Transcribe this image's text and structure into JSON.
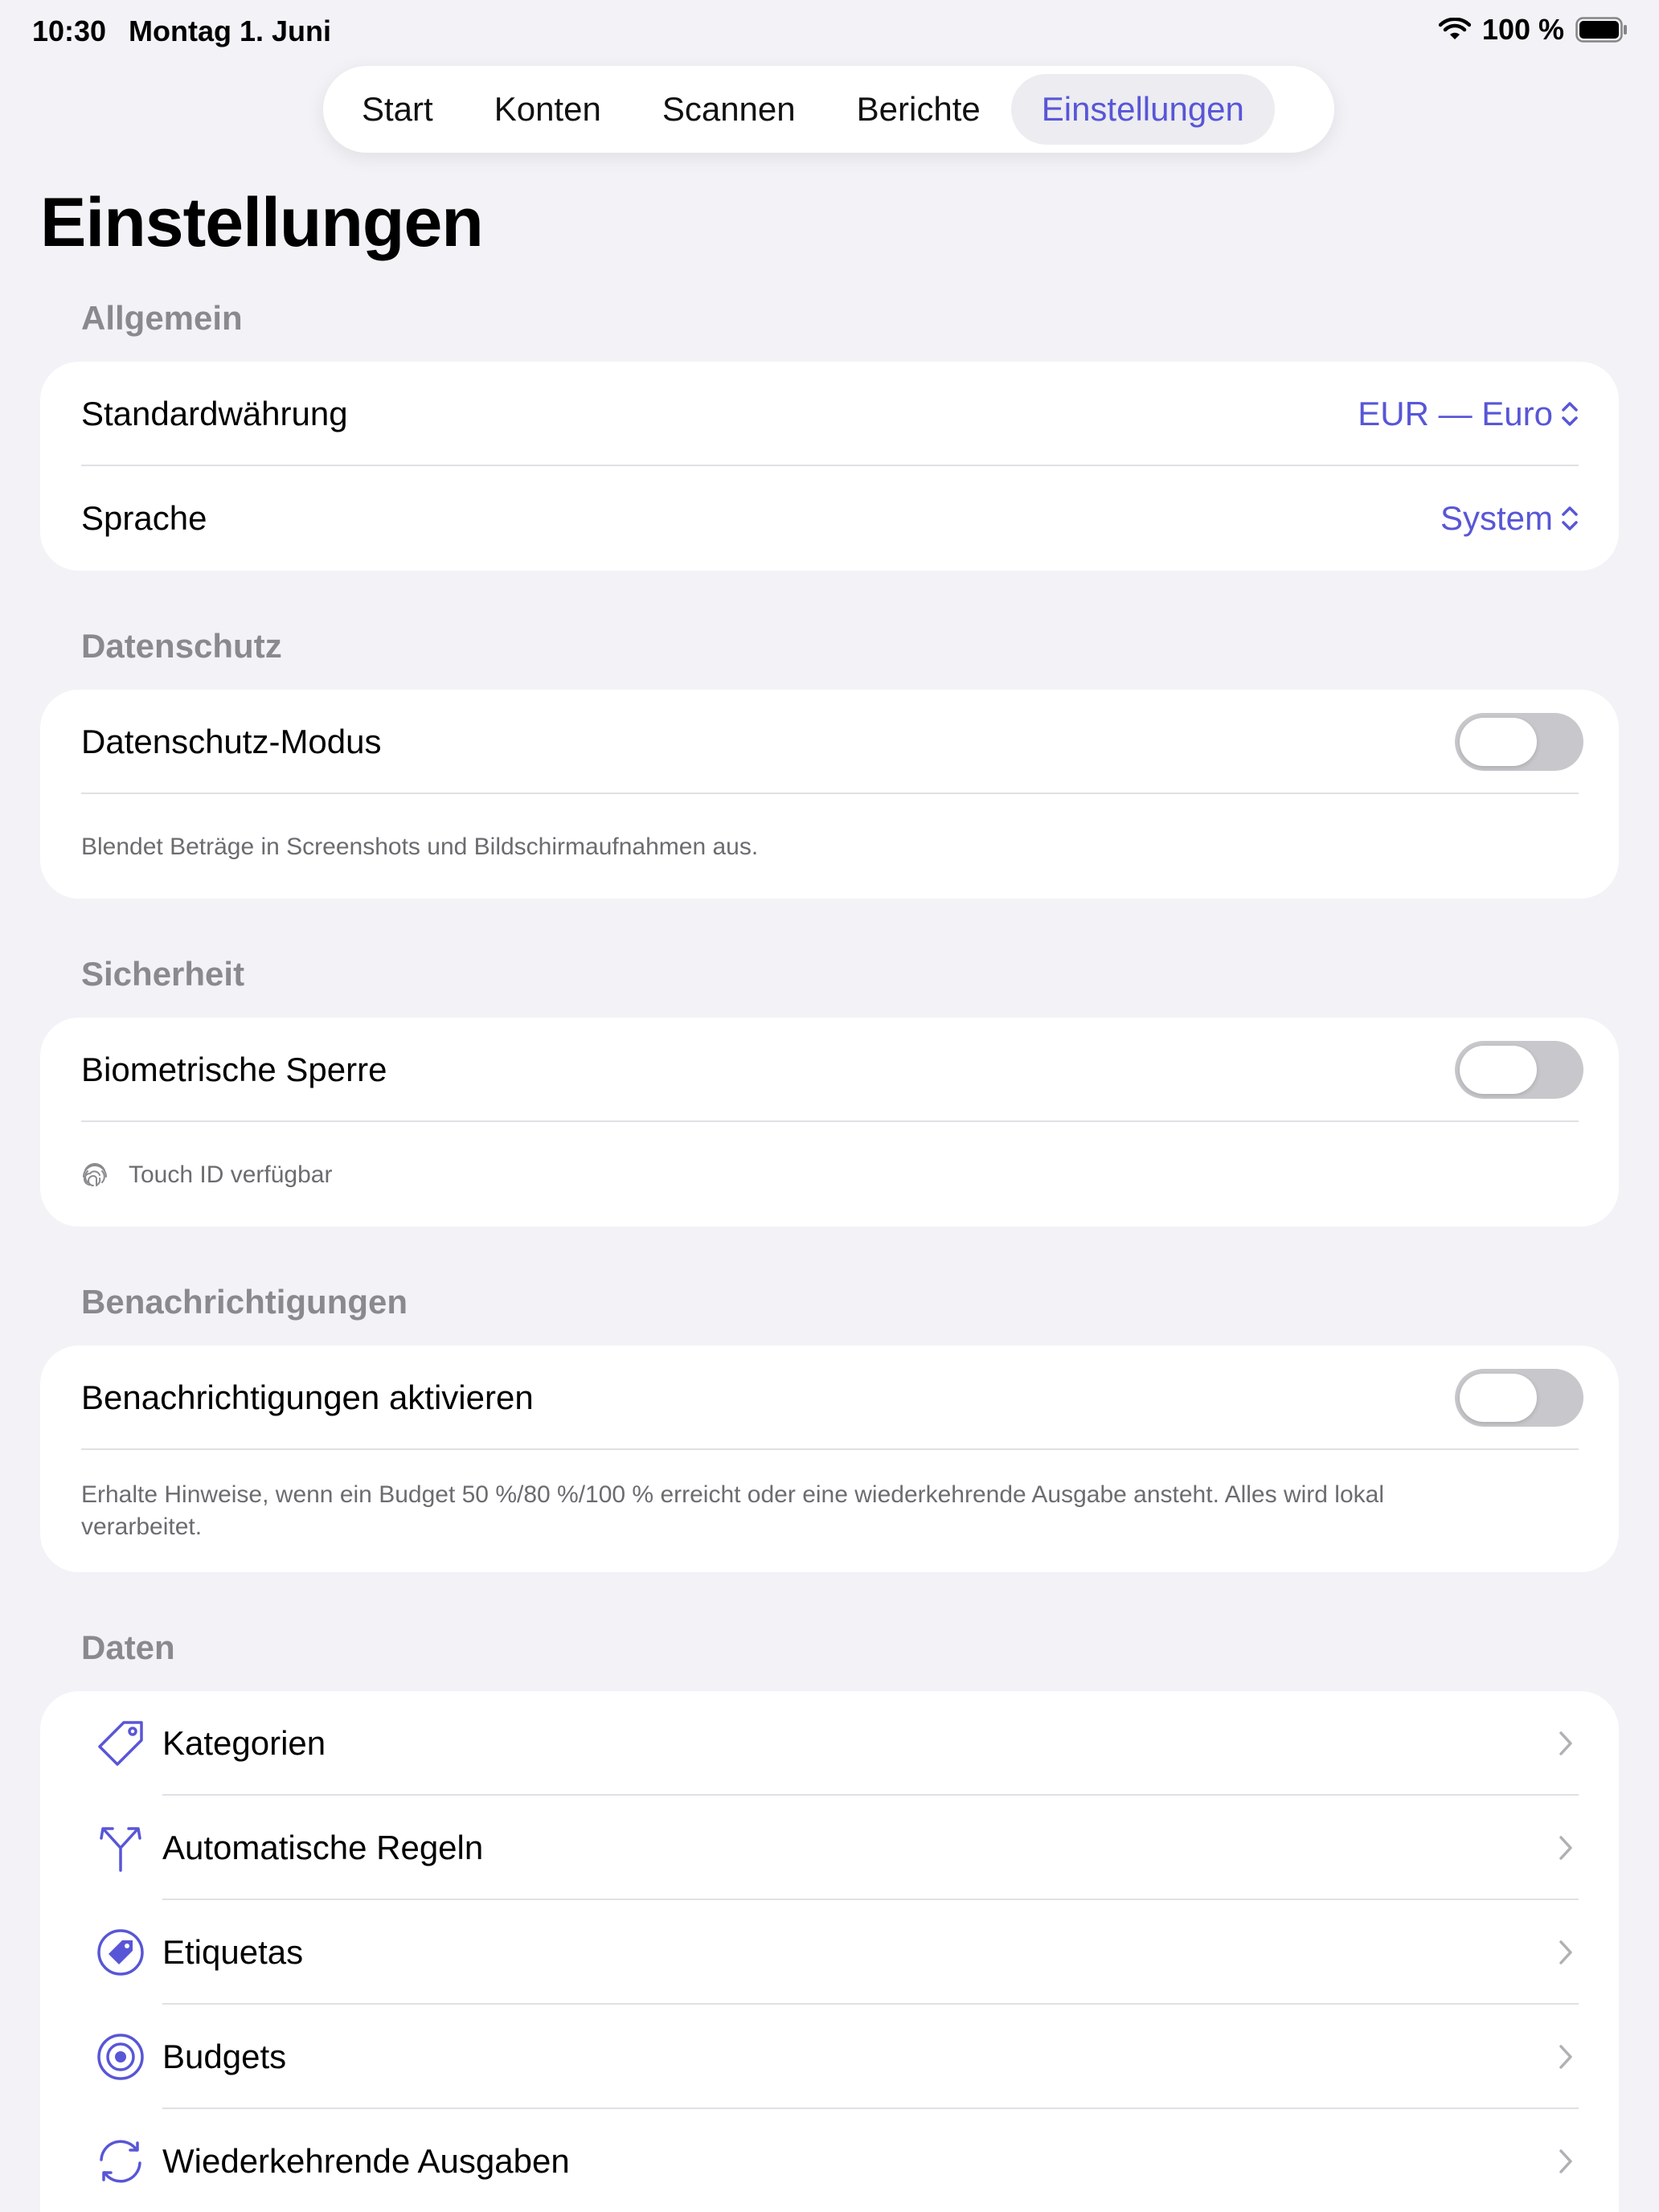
{
  "status": {
    "time": "10:30",
    "date": "Montag 1. Juni",
    "battery": "100 %"
  },
  "tabs": [
    {
      "label": "Start"
    },
    {
      "label": "Konten"
    },
    {
      "label": "Scannen"
    },
    {
      "label": "Berichte"
    },
    {
      "label": "Einstellungen",
      "active": true
    }
  ],
  "page_title": "Einstellungen",
  "general": {
    "header": "Allgemein",
    "currency_label": "Standardwährung",
    "currency_value": "EUR — Euro",
    "language_label": "Sprache",
    "language_value": "System"
  },
  "privacy": {
    "header": "Datenschutz",
    "toggle_label": "Datenschutz-Modus",
    "toggle_on": false,
    "footnote": "Blendet Beträge in Screenshots und Bildschirmaufnahmen aus."
  },
  "security": {
    "header": "Sicherheit",
    "toggle_label": "Biometrische Sperre",
    "toggle_on": false,
    "footnote": "Touch ID verfügbar"
  },
  "notifications": {
    "header": "Benachrichtigungen",
    "toggle_label": "Benachrichtigungen aktivieren",
    "toggle_on": false,
    "footnote": "Erhalte Hinweise, wenn ein Budget 50 %/80 %/100 % erreicht oder eine wiederkehrende Ausgabe ansteht. Alles wird lokal verarbeitet."
  },
  "data": {
    "header": "Daten",
    "items": [
      {
        "label": "Kategorien",
        "icon": "tag-icon"
      },
      {
        "label": "Automatische Regeln",
        "icon": "split-arrow-icon"
      },
      {
        "label": "Etiquetas",
        "icon": "tag-circle-icon"
      },
      {
        "label": "Budgets",
        "icon": "target-icon"
      },
      {
        "label": "Wiederkehrende Ausgaben",
        "icon": "repeat-icon"
      }
    ]
  },
  "colors": {
    "accent": "#5856d6",
    "background": "#f2f2f7",
    "card": "#ffffff",
    "toggle_off": "#c8c8cc",
    "secondary_text": "#8a8a8e"
  }
}
